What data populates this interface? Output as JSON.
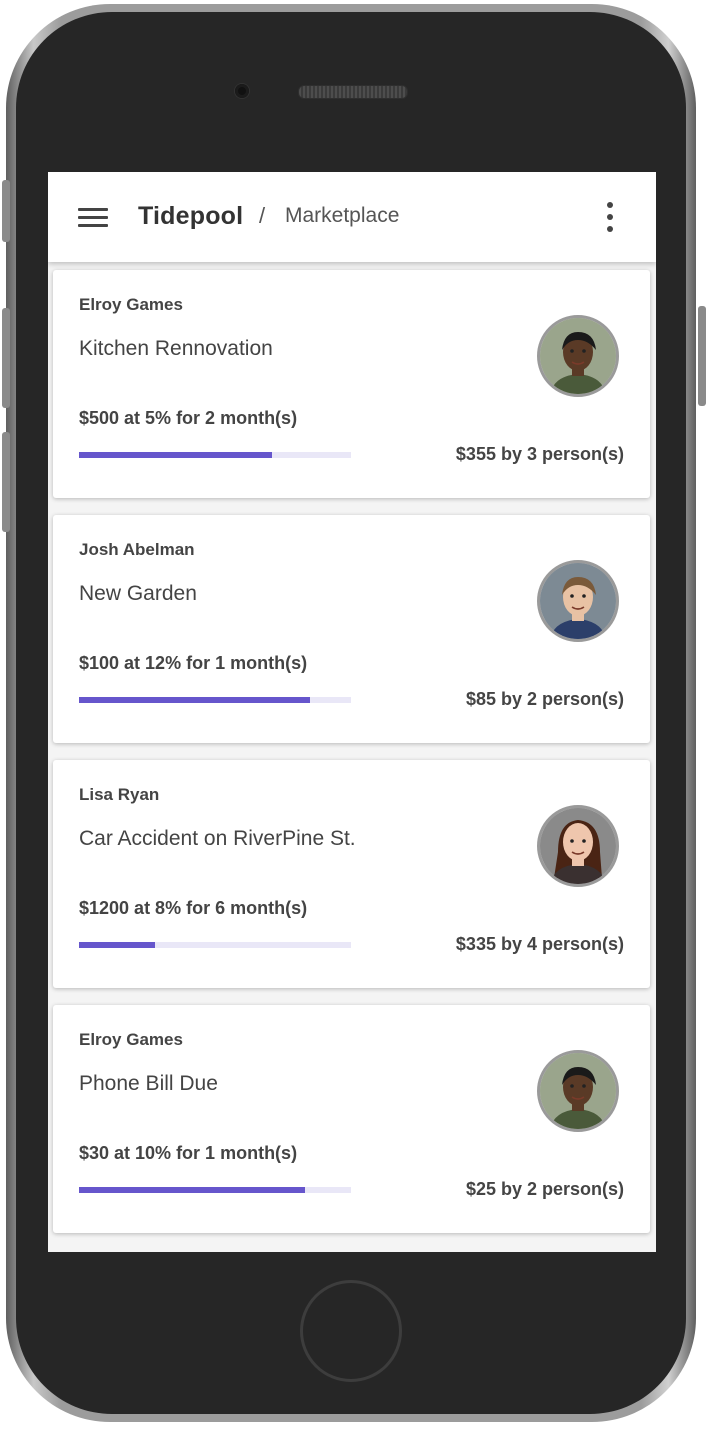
{
  "app": {
    "brand": "Tidepool",
    "separator": "/",
    "breadcrumb": "Marketplace",
    "menu_icon": "hamburger-menu-icon",
    "more_icon": "more-vertical-icon"
  },
  "colors": {
    "accent": "#6656cc",
    "progress_track": "#e9e7f7",
    "text": "#444444"
  },
  "loans": [
    {
      "owner": "Elroy Games",
      "title": "Kitchen Rennovation",
      "terms": "$500 at 5% for 2 month(s)",
      "raised": "$355 by 3 person(s)",
      "progress": 0.71,
      "avatar": "avatar-elroy"
    },
    {
      "owner": "Josh Abelman",
      "title": "New Garden",
      "terms": "$100 at 12% for 1 month(s)",
      "raised": "$85 by 2 person(s)",
      "progress": 0.85,
      "avatar": "avatar-josh"
    },
    {
      "owner": "Lisa Ryan",
      "title": "Car Accident on RiverPine St.",
      "terms": "$1200 at 8% for 6 month(s)",
      "raised": "$335 by 4 person(s)",
      "progress": 0.28,
      "avatar": "avatar-lisa"
    },
    {
      "owner": "Elroy Games",
      "title": "Phone Bill Due",
      "terms": "$30 at 10% for 1 month(s)",
      "raised": "$25 by 2 person(s)",
      "progress": 0.83,
      "avatar": "avatar-elroy"
    }
  ]
}
